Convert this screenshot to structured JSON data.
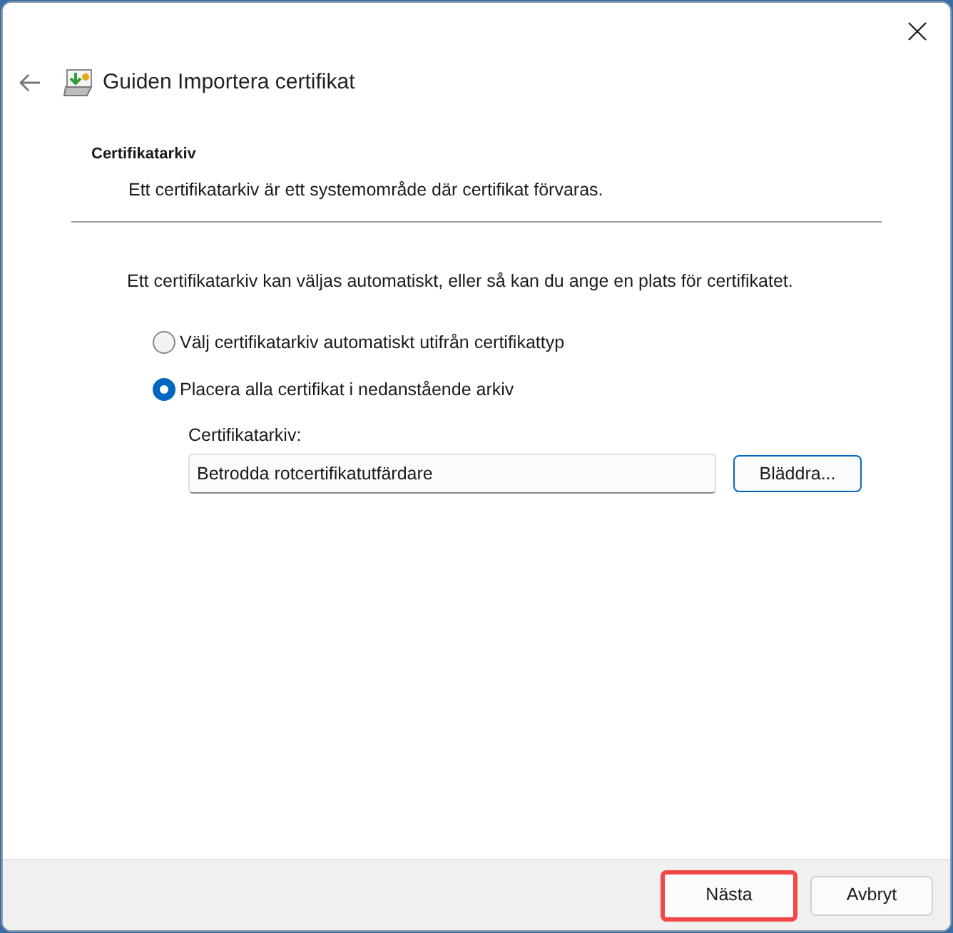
{
  "window": {
    "title": "Guiden Importera certifikat"
  },
  "section": {
    "heading": "Certifikatarkiv",
    "description": "Ett certifikatarkiv är ett systemområde där certifikat förvaras."
  },
  "intro": "Ett certifikatarkiv kan väljas automatiskt, eller så kan du ange en plats för certifikatet.",
  "options": [
    {
      "label": "Välj certifikatarkiv automatiskt utifrån certifikattyp",
      "selected": false
    },
    {
      "label": "Placera alla certifikat i nedanstående arkiv",
      "selected": true
    }
  ],
  "store": {
    "label": "Certifikatarkiv:",
    "value": "Betrodda rotcertifikatutfärdare",
    "browse": "Bläddra..."
  },
  "buttons": [
    {
      "label": "Nästa",
      "highlighted": true
    },
    {
      "label": "Avbryt",
      "highlighted": false
    }
  ]
}
